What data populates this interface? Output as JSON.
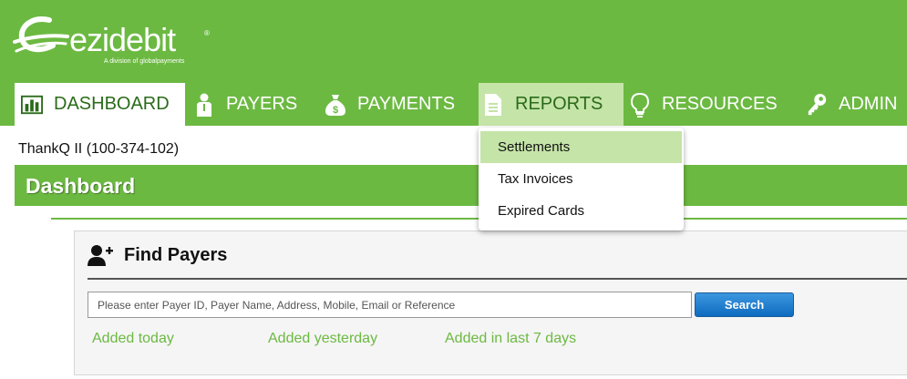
{
  "brand": {
    "logo_text": "ezidebit",
    "tagline": "A division of globalpayments",
    "registered": "®"
  },
  "nav": {
    "items": [
      {
        "label": "DASHBOARD",
        "icon": "bar-chart-icon",
        "state": "active"
      },
      {
        "label": "PAYERS",
        "icon": "person-icon",
        "state": "normal"
      },
      {
        "label": "PAYMENTS",
        "icon": "money-bag-icon",
        "state": "normal"
      },
      {
        "label": "REPORTS",
        "icon": "document-icon",
        "state": "hover"
      },
      {
        "label": "RESOURCES",
        "icon": "lightbulb-icon",
        "state": "normal"
      },
      {
        "label": "ADMIN",
        "icon": "key-icon",
        "state": "normal"
      }
    ]
  },
  "reports_menu": {
    "items": [
      {
        "label": "Settlements",
        "state": "highlighted"
      },
      {
        "label": "Tax Invoices",
        "state": "normal"
      },
      {
        "label": "Expired Cards",
        "state": "normal"
      }
    ]
  },
  "account": {
    "label": "ThankQ II (100-374-102)"
  },
  "page": {
    "title": "Dashboard"
  },
  "find_payers": {
    "title": "Find Payers",
    "icon": "add-person-icon",
    "search_placeholder": "Please enter Payer ID, Payer Name, Address, Mobile, Email or Reference",
    "search_value": "",
    "search_button": "Search",
    "quick_links": [
      "Added today",
      "Added yesterday",
      "Added in last 7 days"
    ]
  },
  "colors": {
    "brand_green": "#6cb942",
    "menu_highlight": "#c5e4a8",
    "button_blue": "#0d6bbf"
  }
}
